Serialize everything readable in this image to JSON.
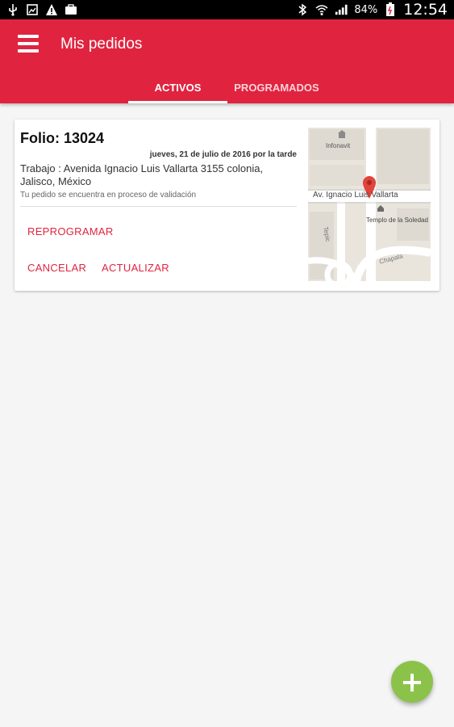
{
  "statusbar": {
    "icons_left": [
      "usb-icon",
      "image-off-icon",
      "warning-icon",
      "briefcase-icon"
    ],
    "icons_right": [
      "bluetooth-icon",
      "wifi-icon",
      "signal-icon",
      "battery-icon"
    ],
    "battery": "84%",
    "time": "12:54"
  },
  "appbar": {
    "title": "Mis pedidos",
    "color": "#e0243f"
  },
  "tabs": [
    {
      "label": "ACTIVOS",
      "active": true
    },
    {
      "label": "PROGRAMADOS",
      "active": false
    }
  ],
  "order": {
    "folio": "Folio: 13024",
    "date": "jueves, 21 de julio de 2016 por la tarde",
    "address": "Trabajo : Avenida Ignacio Luis Vallarta 3155 colonia, Jalisco, México",
    "status": "Tu pedido se encuentra en proceso de validación",
    "actions": {
      "reprogramar": "REPROGRAMAR",
      "cancelar": "CANCELAR",
      "actualizar": "ACTUALIZAR"
    },
    "map": {
      "labels": {
        "infonavit": "Infonavit",
        "street": "Av. Ignacio Luis Vallarta",
        "temple": "Templo de la Soledad",
        "tepic": "Tepic",
        "chapala": "Chapala"
      }
    }
  },
  "fab": {
    "icon": "plus-icon",
    "color": "#8bc34a"
  }
}
